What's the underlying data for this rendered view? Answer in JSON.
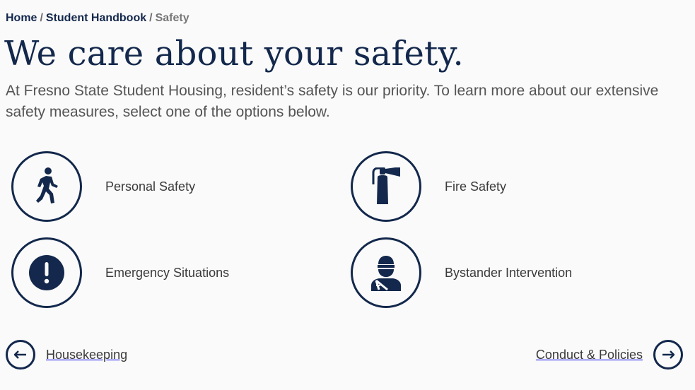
{
  "breadcrumb": {
    "home": "Home",
    "separator": "/",
    "handbook": "Student Handbook",
    "current": "Safety"
  },
  "page": {
    "title": "We care about your safety.",
    "intro": "At Fresno State Student Housing, resident’s safety is our priority. To learn more about our extensive safety measures, select one of the options below."
  },
  "options": [
    {
      "label": "Personal Safety",
      "icon": "walking-person-icon"
    },
    {
      "label": "Fire Safety",
      "icon": "fire-extinguisher-icon"
    },
    {
      "label": "Emergency Situations",
      "icon": "exclamation-icon"
    },
    {
      "label": "Bystander Intervention",
      "icon": "injured-person-icon"
    }
  ],
  "nav": {
    "prev_label": "Housekeeping",
    "next_label": "Conduct & Policies"
  },
  "colors": {
    "brand": "#13284c",
    "text": "#3a3a3a",
    "muted": "#777777",
    "background": "#fafafa"
  }
}
